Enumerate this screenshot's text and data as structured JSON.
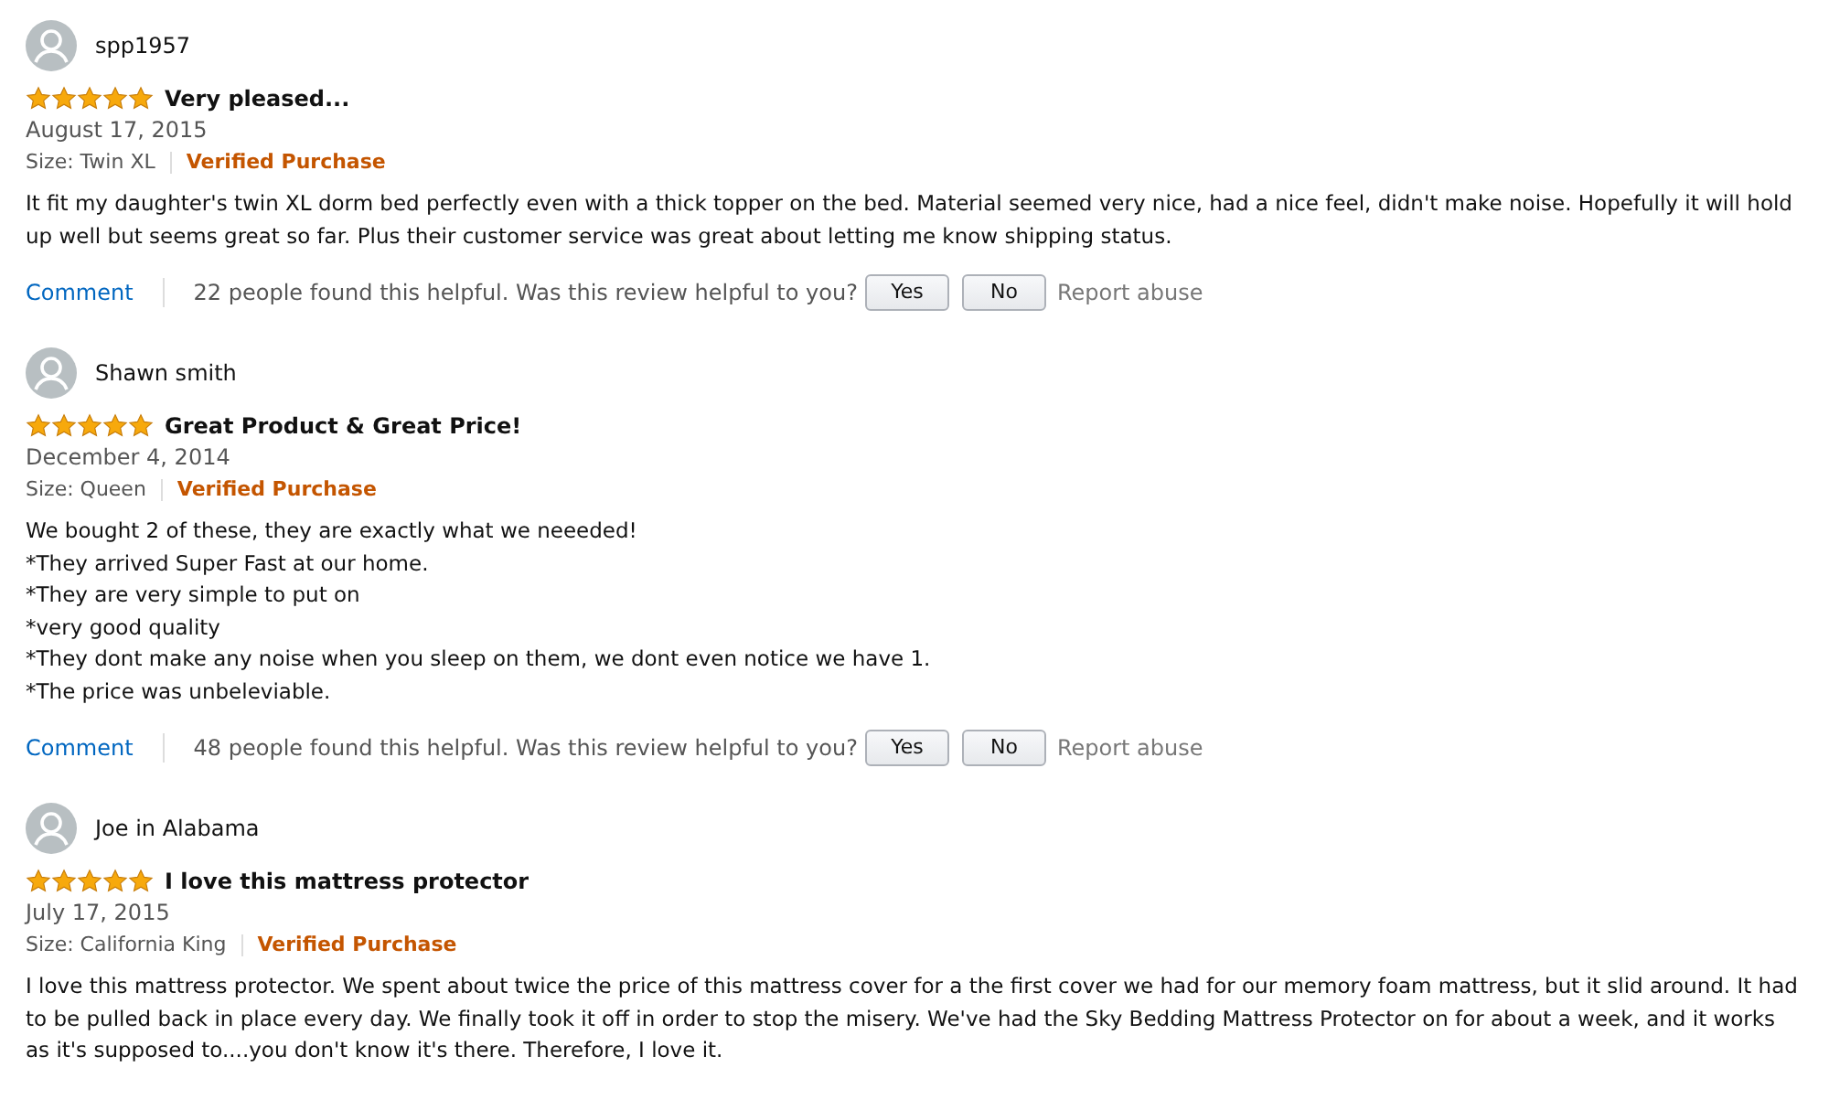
{
  "reviews": [
    {
      "author": "spp1957",
      "stars": 5,
      "title": "Very pleased...",
      "date": "August 17, 2015",
      "size": "Size: Twin XL",
      "verified": "Verified Purchase",
      "body": [
        "It fit my daughter's twin XL dorm bed perfectly even with a thick topper on the bed. Material seemed very nice, had a nice feel, didn't make noise. Hopefully it will hold up well but seems great so far. Plus their customer service was great about letting me know shipping status."
      ],
      "actions": {
        "comment": "Comment",
        "helpful": "22 people found this helpful. Was this review helpful to you?",
        "yes": "Yes",
        "no": "No",
        "report": "Report abuse"
      }
    },
    {
      "author": "Shawn smith",
      "stars": 5,
      "title": "Great Product & Great Price!",
      "date": "December 4, 2014",
      "size": "Size: Queen",
      "verified": "Verified Purchase",
      "body": [
        "We bought 2 of these, they are exactly what we neeeded!",
        "*They arrived Super Fast at our home.",
        "*They are very simple to put on",
        "*very good quality",
        "*They dont make any noise when you sleep on them, we dont even notice we have 1.",
        "*The price was unbeleviable."
      ],
      "actions": {
        "comment": "Comment",
        "helpful": "48 people found this helpful. Was this review helpful to you?",
        "yes": "Yes",
        "no": "No",
        "report": "Report abuse"
      }
    },
    {
      "author": "Joe in Alabama",
      "stars": 5,
      "title": "I love this mattress protector",
      "date": "July 17, 2015",
      "size": "Size: California King",
      "verified": "Verified Purchase",
      "body": [
        "I love this mattress protector. We spent about twice the price of this mattress cover for a the first cover we had for our memory foam mattress, but it slid around. It had to be pulled back in place every day. We finally took it off in order to stop the misery. We've had the Sky Bedding Mattress Protector on for about a week, and it works as it's supposed to....you don't know it's there. Therefore, I love it."
      ]
    }
  ]
}
